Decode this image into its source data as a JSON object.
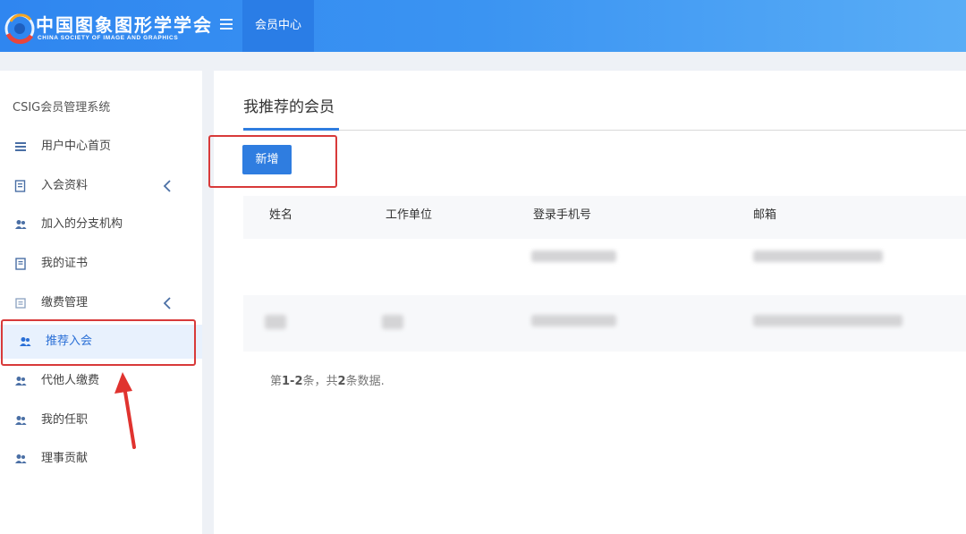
{
  "header": {
    "logo_cn": "中国图象图形学学会",
    "logo_en": "CHINA SOCIETY OF IMAGE AND GRAPHICS",
    "nav_tab": "会员中心"
  },
  "sidebar": {
    "system_title": "CSIG会员管理系统",
    "items": [
      {
        "label": "用户中心首页",
        "icon": "list-icon"
      },
      {
        "label": "入会资料",
        "icon": "form-icon",
        "expandable": true
      },
      {
        "label": "加入的分支机构",
        "icon": "users-icon"
      },
      {
        "label": "我的证书",
        "icon": "certificate-icon"
      },
      {
        "label": "缴费管理",
        "icon": "payment-icon",
        "expandable": true
      },
      {
        "label": "推荐入会",
        "icon": "users-icon",
        "active": true
      },
      {
        "label": "代他人缴费",
        "icon": "users-icon"
      },
      {
        "label": "我的任职",
        "icon": "users-icon"
      },
      {
        "label": "理事贡献",
        "icon": "users-icon"
      }
    ]
  },
  "main": {
    "page_title": "我推荐的会员",
    "add_button": "新增",
    "table": {
      "columns": [
        "姓名",
        "工作单位",
        "登录手机号",
        "邮箱"
      ]
    },
    "summary": {
      "prefix": "第",
      "range": "1-2",
      "middle": "条，共",
      "total": "2",
      "suffix": "条数据."
    }
  },
  "colors": {
    "accent": "#2f7de0",
    "header": "#3b94f2",
    "highlight": "#d83a3a"
  }
}
